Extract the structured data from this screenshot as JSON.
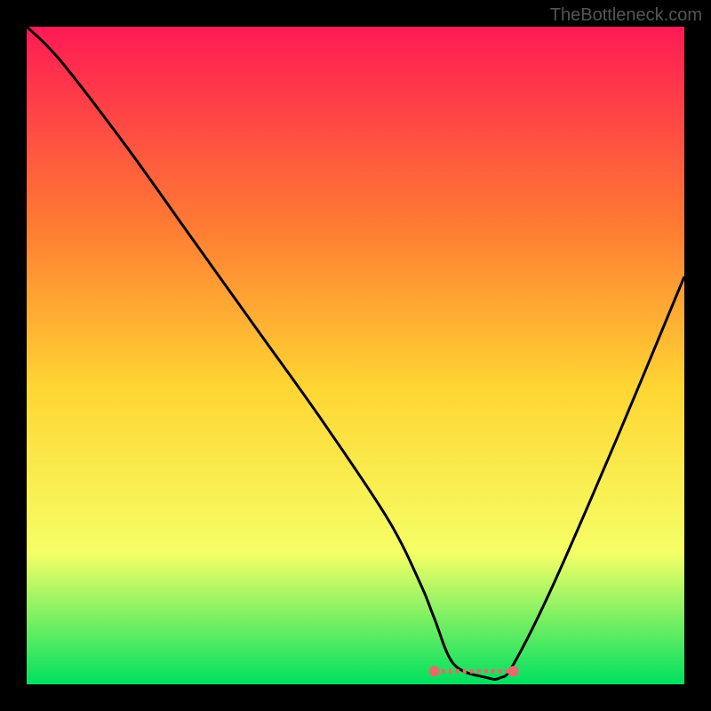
{
  "watermark": "TheBottleneck.com",
  "chart_data": {
    "type": "line",
    "title": "",
    "xlabel": "",
    "ylabel": "",
    "xlim": [
      0,
      100
    ],
    "ylim": [
      0,
      100
    ],
    "background_gradient": {
      "top": "#ff1a55",
      "mid1": "#ff7a33",
      "mid2": "#ffd633",
      "mid3": "#f5ff66",
      "bottom": "#00e060"
    },
    "curve": {
      "description": "V-shaped bottleneck curve",
      "x": [
        0,
        5,
        15,
        25,
        35,
        45,
        55,
        60,
        62,
        65,
        70,
        72,
        74,
        80,
        90,
        100
      ],
      "y": [
        100,
        95,
        82,
        68,
        54,
        40,
        25,
        15,
        10,
        3,
        1,
        1,
        3,
        15,
        38,
        62
      ]
    },
    "valley_marker": {
      "color": "#e86a6a",
      "x_range": [
        62,
        74
      ],
      "y": 2
    }
  }
}
